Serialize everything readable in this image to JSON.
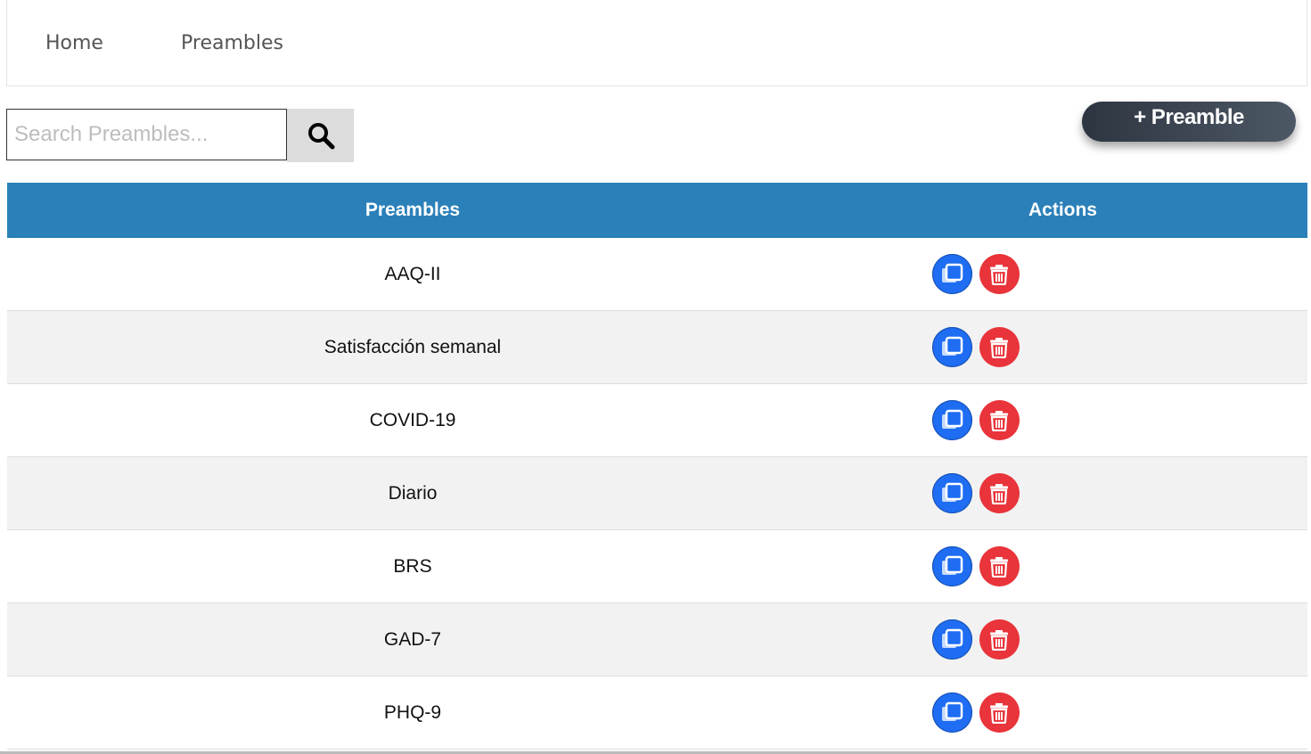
{
  "nav": {
    "home": "Home",
    "preambles": "Preambles"
  },
  "search": {
    "placeholder": "Search Preambles...",
    "value": ""
  },
  "add_button_label": "+ Preamble",
  "table": {
    "headers": [
      "Preambles",
      "Actions"
    ],
    "rows": [
      "AAQ-II",
      "Satisfacción semanal",
      "COVID-19",
      "Diario",
      "BRS",
      "GAD-7",
      "PHQ-9"
    ]
  },
  "colors": {
    "header_bg": "#2b80b9",
    "copy": "#1e6df2",
    "delete": "#e8343a"
  },
  "icons": {
    "search": "search-icon",
    "copy": "copy-icon",
    "delete": "trash-icon"
  }
}
